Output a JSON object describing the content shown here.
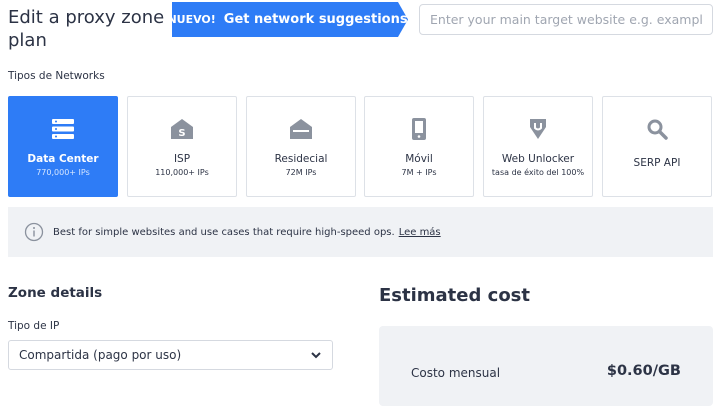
{
  "header": {
    "title": "Edit a proxy zone plan",
    "promo_badge": "¡NUEVO!",
    "promo_label": "Get network suggestions",
    "search_placeholder": "Enter your main target website e.g. example.com"
  },
  "networks": {
    "section_label": "Tipos de Networks",
    "selected": "Data Center",
    "cards": [
      {
        "name": "Data Center",
        "sub": "770,000+ IPs",
        "icon": "server-icon"
      },
      {
        "name": "ISP",
        "sub": "110,000+ IPs",
        "icon": "isp-house-icon"
      },
      {
        "name": "Residecial",
        "sub": "72M IPs",
        "icon": "house-icon"
      },
      {
        "name": "Móvil",
        "sub": "7M + IPs",
        "icon": "phone-icon"
      },
      {
        "name": "Web Unlocker",
        "sub": "tasa de éxito del 100%",
        "icon": "unlock-shield-icon"
      },
      {
        "name": "SERP API",
        "sub": "",
        "icon": "search-icon"
      }
    ]
  },
  "info": {
    "text": "Best for simple websites and use cases that require high-speed ops.",
    "link": "Lee más"
  },
  "zone_details": {
    "title": "Zone details",
    "ip_type_label": "Tipo de IP",
    "ip_type_value": "Compartida (pago por uso)"
  },
  "cost": {
    "title": "Estimated cost",
    "monthly_label": "Costo mensual",
    "monthly_value": "$0.60/GB"
  },
  "colors": {
    "accent": "#2e7cf6",
    "text": "#2c3345",
    "panel": "#f0f2f5",
    "icon_gray": "#8b929e"
  }
}
